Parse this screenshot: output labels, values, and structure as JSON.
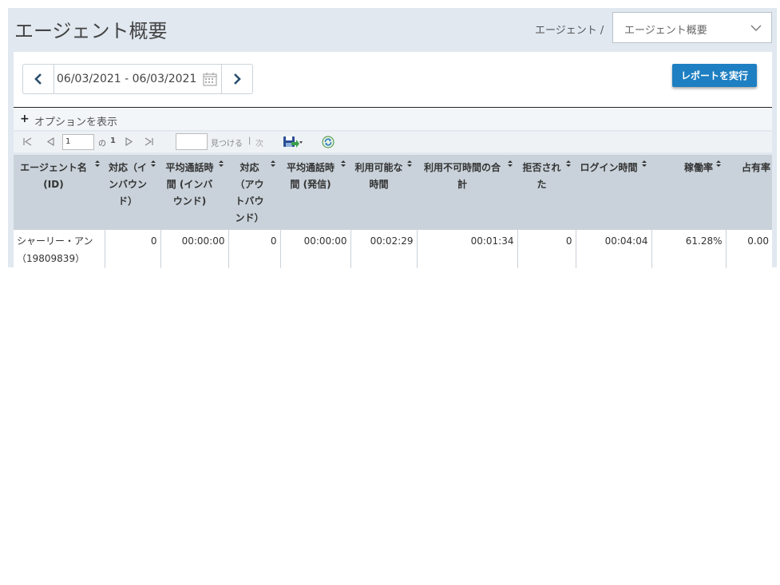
{
  "header": {
    "title": "エージェント概要",
    "breadcrumb": "エージェント /",
    "report_select_value": "エージェント概要"
  },
  "date_range": {
    "value": "06/03/2021 - 06/03/2021"
  },
  "buttons": {
    "run_report": "レポートを実行"
  },
  "options": {
    "toggle_symbol": "+",
    "label": "オプションを表示"
  },
  "toolbar": {
    "page_value": "1",
    "of_label": "の",
    "total_pages": "1",
    "find_label": "見つける",
    "separator": "|",
    "next_label": "次"
  },
  "table": {
    "columns": [
      "エージェント名 (ID)",
      "対応（インバウンド）",
      "平均通話時間 (インバウンド)",
      "対応（アウトバウンド）",
      "平均通話時間 (発信)",
      "利用可能な時間",
      "利用不可時間の合計",
      "拒否された",
      "ログイン時間",
      "稼働率",
      "占有率"
    ],
    "rows": [
      [
        "シャーリー・アン（19809839）",
        "0",
        "00:00:00",
        "0",
        "00:00:00",
        "00:02:29",
        "00:01:34",
        "0",
        "00:04:04",
        "61.28%",
        "0.00"
      ]
    ]
  },
  "icons": {
    "prev": "chevron-left-icon",
    "next": "chevron-right-icon",
    "calendar": "calendar-icon",
    "select": "chevron-down-icon",
    "first": "first-page-icon",
    "prev_page": "prev-page-icon",
    "next_page": "next-page-icon",
    "last": "last-page-icon",
    "save": "save-icon",
    "refresh": "refresh-icon",
    "sort": "sort-icon"
  },
  "colors": {
    "accent": "#1e7fc2",
    "header_bg": "#e1e8f0",
    "table_header_bg": "#c9d2da"
  }
}
